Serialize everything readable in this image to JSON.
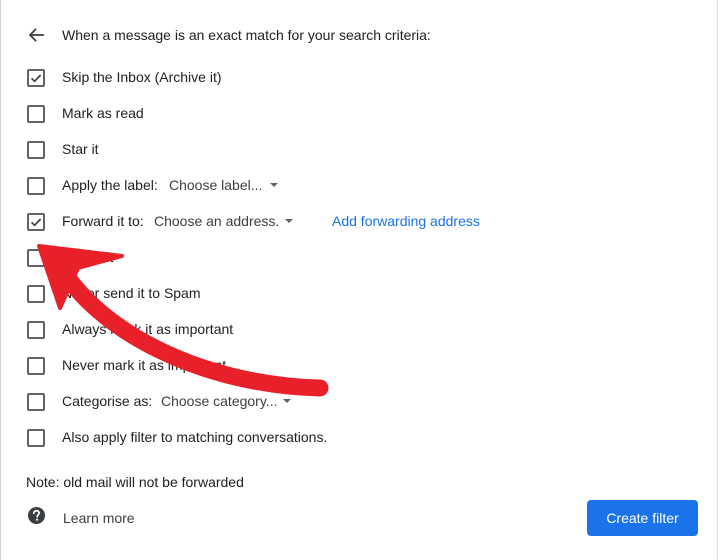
{
  "header": {
    "title": "When a message is an exact match for your search criteria:",
    "back_icon": "arrow-back-icon"
  },
  "options": [
    {
      "label": "Skip the Inbox (Archive it)",
      "checked": true
    },
    {
      "label": "Mark as read",
      "checked": false
    },
    {
      "label": "Star it",
      "checked": false
    },
    {
      "label": "Apply the label:",
      "checked": false,
      "select_value": "Choose label..."
    },
    {
      "label": "Forward it to:",
      "checked": true,
      "select_value": "Choose an address.",
      "link": "Add forwarding address"
    },
    {
      "label": "Delete it",
      "checked": false
    },
    {
      "label": "Never send it to Spam",
      "checked": false
    },
    {
      "label": "Always mark it as important",
      "checked": false
    },
    {
      "label": "Never mark it as important",
      "checked": false
    },
    {
      "label": "Categorise as:",
      "checked": false,
      "select_value": "Choose category..."
    },
    {
      "label": "Also apply filter to matching conversations.",
      "checked": false
    }
  ],
  "note": "Note: old mail will not be forwarded",
  "footer": {
    "learn_more": "Learn more",
    "help_icon": "help-circle-icon",
    "create_filter": "Create filter"
  },
  "annotation": {
    "arrow_color": "#e8202a"
  }
}
